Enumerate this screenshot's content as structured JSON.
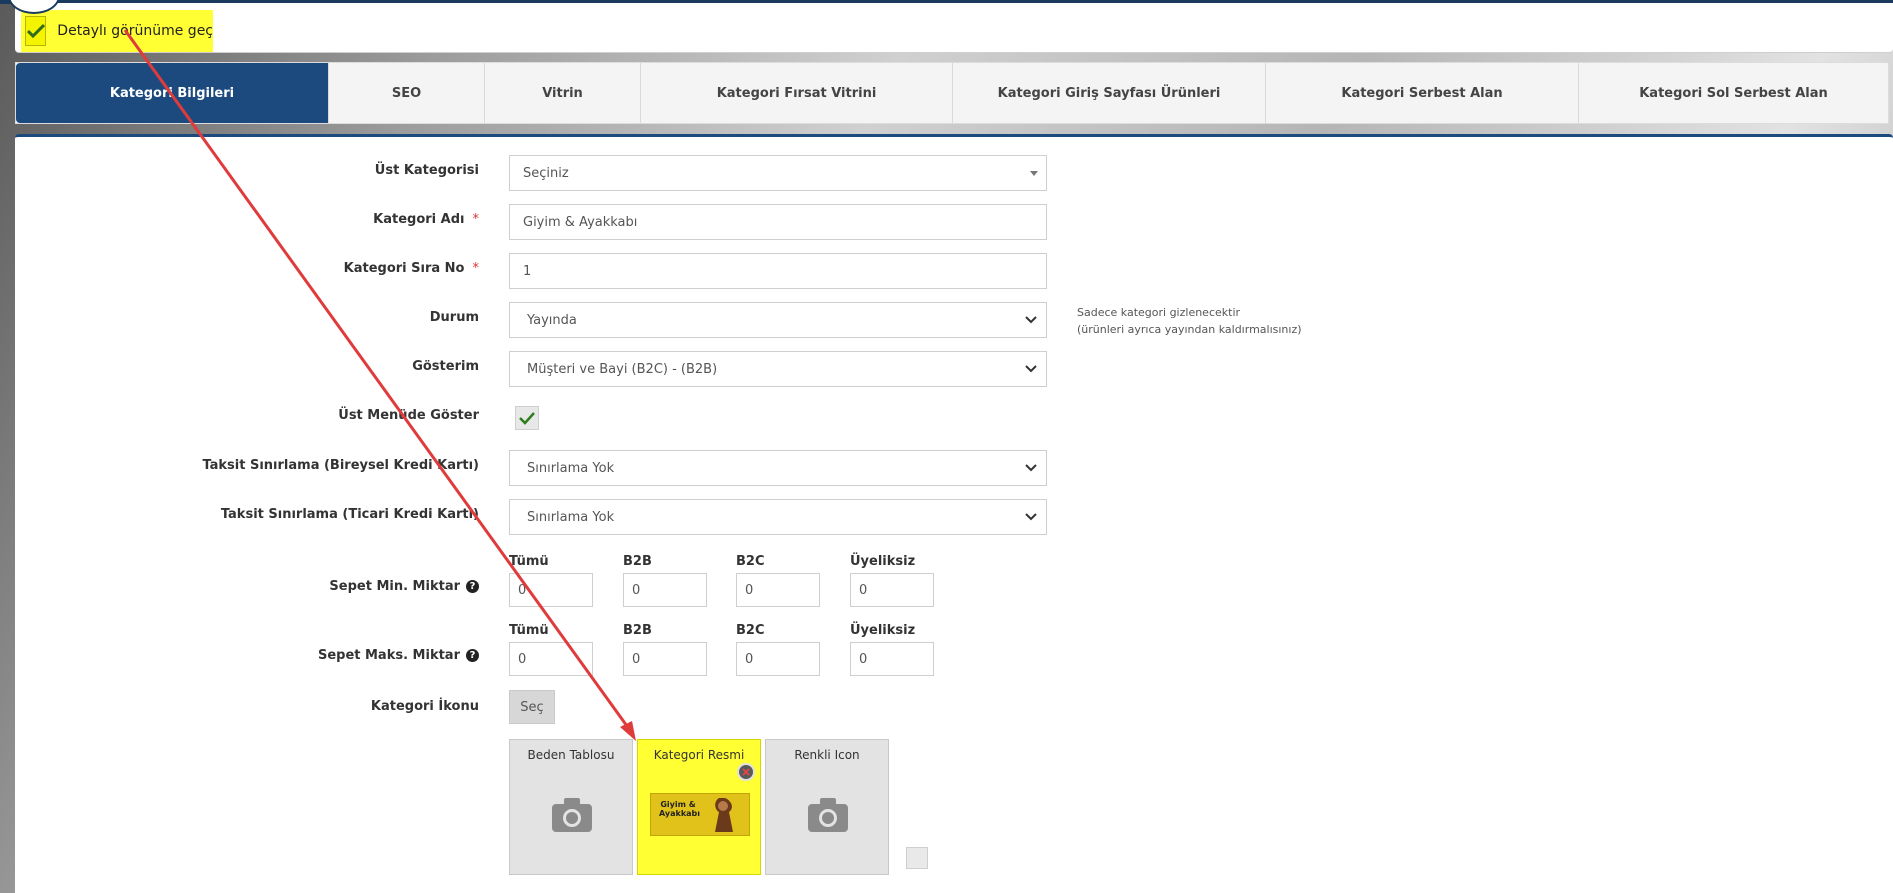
{
  "toggle": {
    "label": "Detaylı görünüme geç"
  },
  "tabs": [
    {
      "label": "Kategori Bilgileri"
    },
    {
      "label": "SEO"
    },
    {
      "label": "Vitrin"
    },
    {
      "label": "Kategori Fırsat Vitrini"
    },
    {
      "label": "Kategori Giriş Sayfası Ürünleri"
    },
    {
      "label": "Kategori Serbest Alan"
    },
    {
      "label": "Kategori Sol Serbest Alan"
    }
  ],
  "form": {
    "parent_category": {
      "label": "Üst Kategorisi",
      "value": "Seçiniz"
    },
    "category_name": {
      "label": "Kategori Adı",
      "value": "Giyim & Ayakkabı",
      "required": "*"
    },
    "sort_no": {
      "label": "Kategori Sıra No",
      "value": "1",
      "required": "*"
    },
    "status": {
      "label": "Durum",
      "value": "Yayında",
      "hint_line1": "Sadece kategori gizlenecektir",
      "hint_line2": "(ürünleri ayrıca yayından kaldırmalısınız)"
    },
    "display": {
      "label": "Gösterim",
      "value": "Müşteri ve Bayi (B2C) - (B2B)"
    },
    "top_menu": {
      "label": "Üst Menüde Göster"
    },
    "installment_individual": {
      "label": "Taksit Sınırlama (Bireysel Kredi Kartı)",
      "value": "Sınırlama Yok"
    },
    "installment_commercial": {
      "label": "Taksit Sınırlama (Ticari Kredi Kartı)",
      "value": "Sınırlama Yok"
    },
    "basket_min": {
      "label": "Sepet Min. Miktar",
      "columns": [
        "Tümü",
        "B2B",
        "B2C",
        "Üyeliksiz"
      ],
      "values": [
        "0",
        "0",
        "0",
        "0"
      ]
    },
    "basket_max": {
      "label": "Sepet Maks. Miktar",
      "columns": [
        "Tümü",
        "B2B",
        "B2C",
        "Üyeliksiz"
      ],
      "values": [
        "0",
        "0",
        "0",
        "0"
      ]
    },
    "category_icon": {
      "label": "Kategori İkonu",
      "button": "Seç"
    },
    "images": [
      {
        "title": "Beden Tablosu"
      },
      {
        "title": "Kategori Resmi",
        "thumb_text": "Giyim & Ayakkabı"
      },
      {
        "title": "Renkli Icon"
      }
    ]
  },
  "colors": {
    "accent": "#1c4a7e",
    "highlight": "#ffff33",
    "arrow": "#e03b3b",
    "required": "#dd3333"
  }
}
